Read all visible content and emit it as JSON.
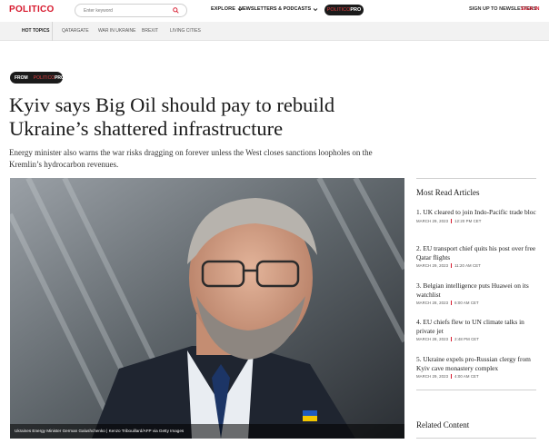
{
  "header": {
    "logo": "POLITICO",
    "search_placeholder": "Enter keyword",
    "explore": "EXPLORE",
    "newsletters_podcasts": "NEWSLETTERS & PODCASTS",
    "pro_politico": "POLITICO",
    "pro_suffix": "PRO",
    "signup": "SIGN UP TO NEWSLETTERS",
    "signin": "SIGN IN"
  },
  "topics": {
    "label": "HOT TOPICS",
    "items": [
      "QATARGATE",
      "WAR IN UKRAINE",
      "BREXIT",
      "LIVING CITIES"
    ]
  },
  "article": {
    "badge_from": "FROM",
    "badge_politico": "POLITICO",
    "badge_pro": "PRO",
    "headline": "Kyiv says Big Oil should pay to rebuild Ukraine’s shattered infrastructure",
    "dek": "Energy minister also warns the war risks dragging on forever unless the West closes sanctions loopholes on the Kremlin’s hydrocarbon revenues.",
    "caption": "Ukraines Energy Minister German Galushchenko | Kenzo Tribouillard/AFP via Getty Images"
  },
  "sidebar": {
    "most_read_title": "Most Read Articles",
    "items": [
      {
        "headline": "1. UK cleared to join Indo-Pacific trade bloc",
        "date": "MARCH 29, 2023",
        "time": "12:20 PM CET"
      },
      {
        "headline": "2. EU transport chief quits his post over free Qatar flights",
        "date": "MARCH 29, 2023",
        "time": "11:20 AM CET"
      },
      {
        "headline": "3. Belgian intelligence puts Huawei on its watchlist",
        "date": "MARCH 28, 2023",
        "time": "6:00 AM CET"
      },
      {
        "headline": "4. EU chiefs flew to UN climate talks in private jet",
        "date": "MARCH 28, 2023",
        "time": "2:48 PM CET"
      },
      {
        "headline": "5. Ukraine expels pro-Russian clergy from Kyiv cave monastery complex",
        "date": "MARCH 29, 2023",
        "time": "4:00 AM CET"
      }
    ],
    "related_title": "Related Content"
  },
  "colors": {
    "brand_red": "#d7192d",
    "pill_dark": "#1b1b1b"
  }
}
